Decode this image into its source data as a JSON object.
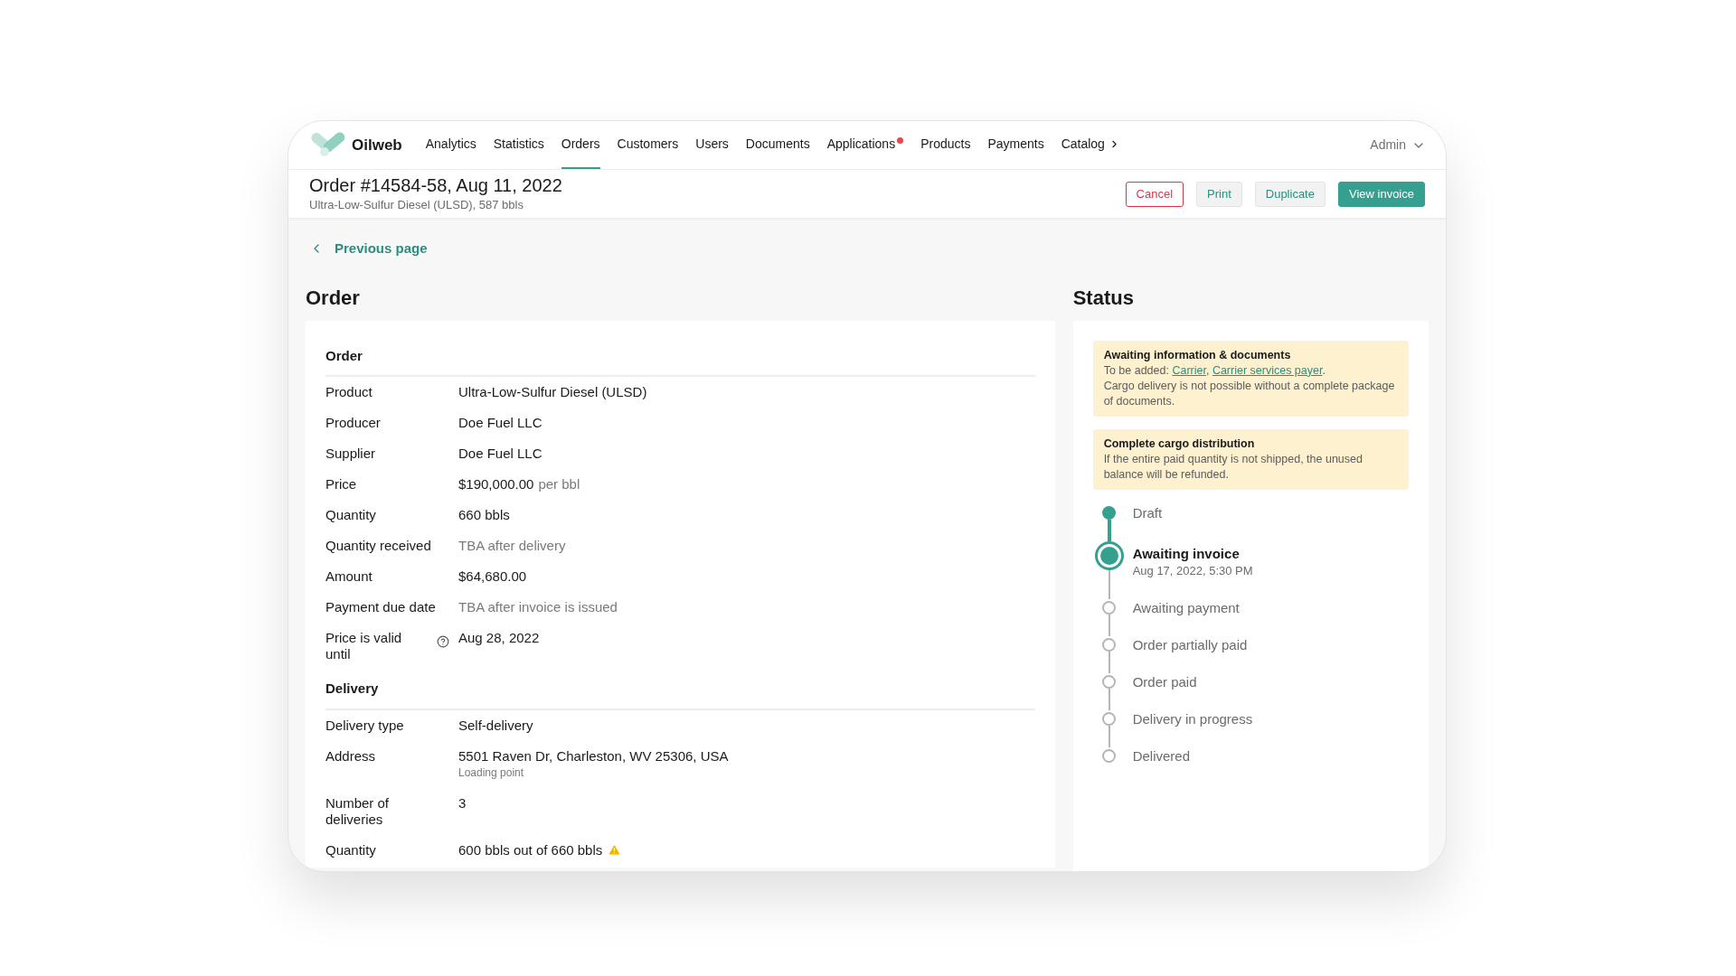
{
  "brand": "Oilweb",
  "nav": [
    {
      "label": "Analytics",
      "selected": false,
      "badge": false,
      "submenu": false
    },
    {
      "label": "Statistics",
      "selected": false,
      "badge": false,
      "submenu": false
    },
    {
      "label": "Orders",
      "selected": true,
      "badge": false,
      "submenu": false
    },
    {
      "label": "Customers",
      "selected": false,
      "badge": false,
      "submenu": false
    },
    {
      "label": "Users",
      "selected": false,
      "badge": false,
      "submenu": false
    },
    {
      "label": "Documents",
      "selected": false,
      "badge": false,
      "submenu": false
    },
    {
      "label": "Applications",
      "selected": false,
      "badge": true,
      "submenu": false
    },
    {
      "label": "Products",
      "selected": false,
      "badge": false,
      "submenu": false
    },
    {
      "label": "Payments",
      "selected": false,
      "badge": false,
      "submenu": false
    },
    {
      "label": "Catalog",
      "selected": false,
      "badge": false,
      "submenu": true
    }
  ],
  "user": "Admin",
  "header": {
    "title": "Order #14584-58, Aug 11, 2022",
    "subtitle": "Ultra-Low-Sulfur Diesel (ULSD), 587 bbls"
  },
  "actions": [
    {
      "label": "Cancel",
      "kind": "danger"
    },
    {
      "label": "Print",
      "kind": "secondary"
    },
    {
      "label": "Duplicate",
      "kind": "secondary"
    },
    {
      "label": "View invoice",
      "kind": "primary"
    }
  ],
  "back_link": "Previous page",
  "order_heading": "Order",
  "sections": [
    {
      "title": "Order",
      "rows": [
        {
          "label": "Product",
          "value": "Ultra-Low-Sulfur Diesel (ULSD)",
          "muted": false
        },
        {
          "label": "Producer",
          "value": "Doe Fuel LLC",
          "muted": false
        },
        {
          "label": "Supplier",
          "value": "Doe Fuel LLC",
          "muted": false
        },
        {
          "label": "Price",
          "value": "$190,000.00",
          "unit": "per bbl",
          "muted": false
        },
        {
          "label": "Quantity",
          "value": "660 bbls",
          "muted": false
        },
        {
          "label": "Quantity received",
          "value": "TBA after delivery",
          "muted": true
        },
        {
          "label": "Amount",
          "value": "$64,680.00",
          "muted": false
        },
        {
          "label": "Payment due date",
          "value": "TBA after invoice is issued",
          "muted": true
        },
        {
          "label": "Price is valid until",
          "value": "Aug 28, 2022",
          "muted": false,
          "help": true
        }
      ]
    },
    {
      "title": "Delivery",
      "rows": [
        {
          "label": "Delivery type",
          "value": "Self-delivery",
          "muted": false
        },
        {
          "label": "Address",
          "value": "5501 Raven Dr, Charleston, WV 25306, USA",
          "note": "Loading point",
          "muted": false
        },
        {
          "label": "Number of deliveries",
          "value": "3",
          "muted": false
        },
        {
          "label": "Quantity",
          "value": "600 bbls out of 660 bbls",
          "muted": false,
          "warning": true
        }
      ]
    }
  ],
  "status_heading": "Status",
  "notices": [
    {
      "title": "Awaiting information & documents",
      "prefix": "To be added: ",
      "links": [
        "Carrier",
        "Carrier services payer"
      ],
      "separator": ", ",
      "suffix": ".",
      "text": "Cargo delivery is not possible without a complete package of documents."
    },
    {
      "title": "Complete cargo distribution",
      "text": "If the entire paid quantity is not shipped, the unused balance will be refunded."
    }
  ],
  "timeline": [
    {
      "label": "Draft",
      "done": true,
      "current": false
    },
    {
      "label": "Awaiting invoice",
      "done": false,
      "current": true,
      "date": "Aug 17, 2022, 5:30  PM"
    },
    {
      "label": "Awaiting payment",
      "done": false,
      "current": false
    },
    {
      "label": "Order partially paid",
      "done": false,
      "current": false
    },
    {
      "label": "Order paid",
      "done": false,
      "current": false
    },
    {
      "label": "Delivery in progress",
      "done": false,
      "current": false
    },
    {
      "label": "Delivered",
      "done": false,
      "current": false
    }
  ]
}
